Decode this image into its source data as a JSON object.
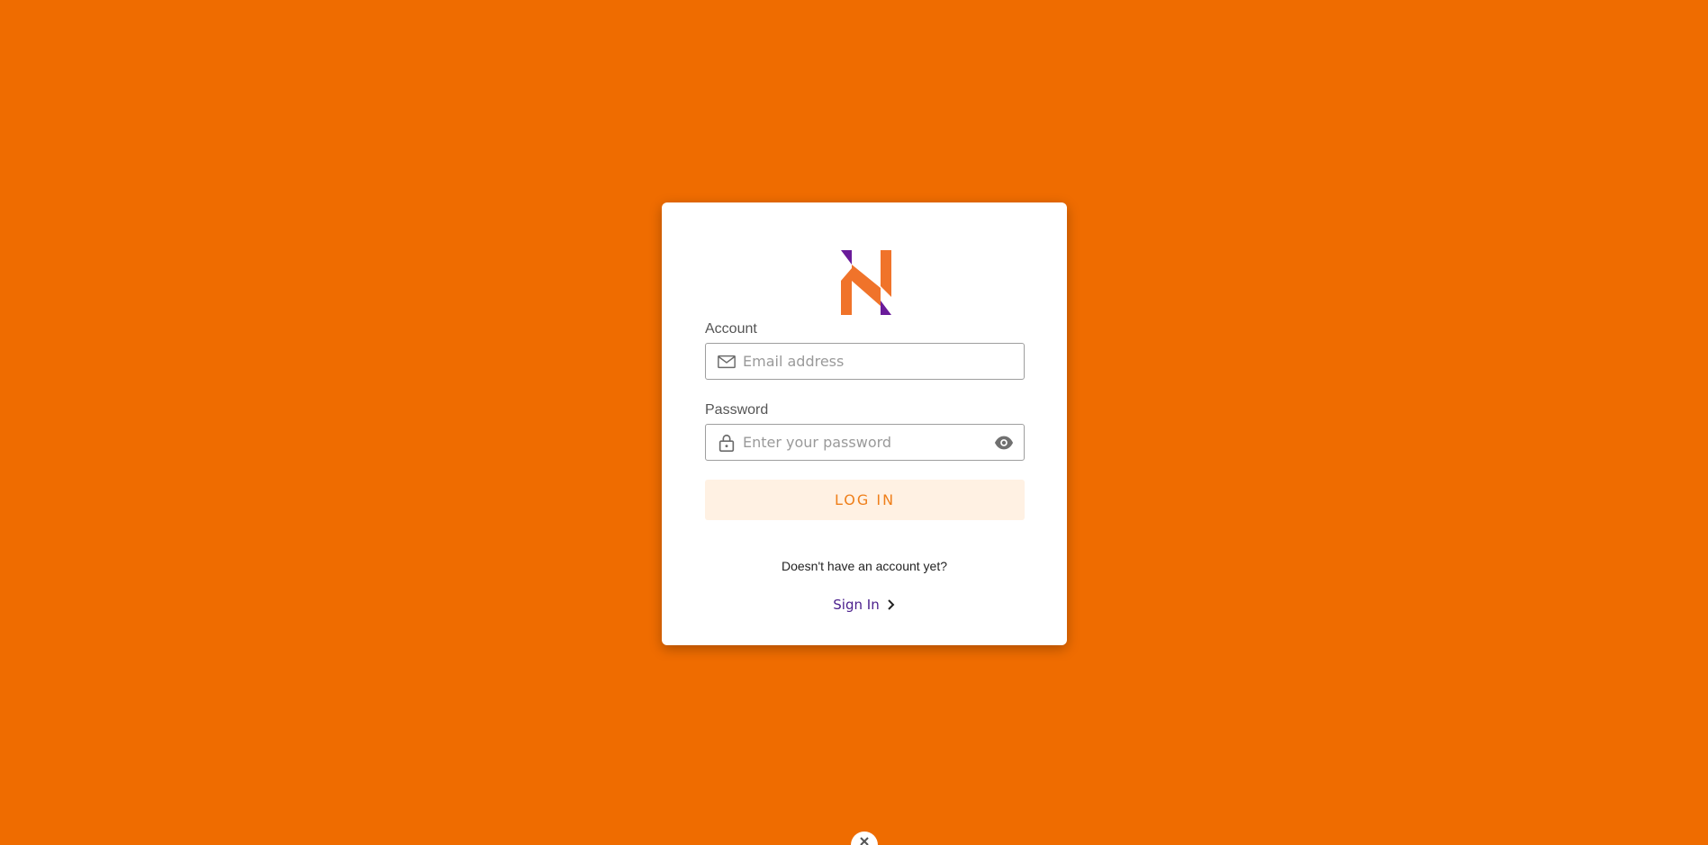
{
  "login_form": {
    "account_label": "Account",
    "email_placeholder": "Email address",
    "email_value": "",
    "password_label": "Password",
    "password_placeholder": "Enter your password",
    "password_value": "",
    "login_button_label": "LOG IN",
    "signup_prompt": "Doesn't have an account yet?",
    "signin_link_label": "Sign In"
  },
  "icons": {
    "email": "mail-icon",
    "password": "lock-icon",
    "visibility": "eye-icon",
    "signin": "chevron-right-icon",
    "bottom_widget": "close-icon"
  },
  "colors": {
    "background": "#EF6C00",
    "logo_orange": "#F0732A",
    "logo_purple": "#6A1B9A",
    "login_button_bg": "#FFF1E3",
    "login_button_text": "#EF7F1A",
    "link": "#4A1E8C"
  }
}
